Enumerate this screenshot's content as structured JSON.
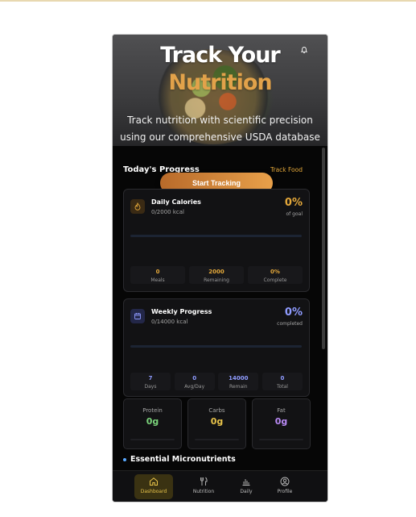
{
  "hero": {
    "title_line1": "Track Your",
    "title_line2": "Nutrition",
    "subtitle": "Track nutrition with scientific precision using our comprehensive USDA database",
    "notification_icon": "bell-icon"
  },
  "progress": {
    "section_title": "Today's Progress",
    "track_food_link": "Track Food",
    "start_button": "Start Tracking"
  },
  "daily_card": {
    "icon": "flame-icon",
    "title": "Daily Calories",
    "subtitle": "0/2000 kcal",
    "percent": "0%",
    "percent_label": "of goal",
    "progress_fraction": 0,
    "stats": [
      {
        "value": "0",
        "label": "Meals"
      },
      {
        "value": "2000",
        "label": "Remaining"
      },
      {
        "value": "0%",
        "label": "Complete"
      }
    ]
  },
  "weekly_card": {
    "icon": "calendar-icon",
    "title": "Weekly Progress",
    "subtitle": "0/14000 kcal",
    "percent": "0%",
    "percent_label": "completed",
    "progress_fraction": 0,
    "stats": [
      {
        "value": "7",
        "label": "Days"
      },
      {
        "value": "0",
        "label": "Avg/Day"
      },
      {
        "value": "14000",
        "label": "Remain"
      },
      {
        "value": "0",
        "label": "Total"
      }
    ]
  },
  "macros": [
    {
      "label": "Protein",
      "value": "0g",
      "color": "#7bd37b"
    },
    {
      "label": "Carbs",
      "value": "0g",
      "color": "#e8c34a"
    },
    {
      "label": "Fat",
      "value": "0g",
      "color": "#b98af5"
    }
  ],
  "micronutrients": {
    "title": "Essential Micronutrients"
  },
  "nav": [
    {
      "label": "Dashboard",
      "icon": "home-icon",
      "active": true
    },
    {
      "label": "Nutrition",
      "icon": "utensils-icon",
      "active": false
    },
    {
      "label": "Daily",
      "icon": "bar-chart-icon",
      "active": false
    },
    {
      "label": "Profile",
      "icon": "user-circle-icon",
      "active": false
    }
  ],
  "colors": {
    "accent_orange": "#e2a24a",
    "daily_value": "#e4a83a",
    "weekly_value": "#8f9bff"
  }
}
